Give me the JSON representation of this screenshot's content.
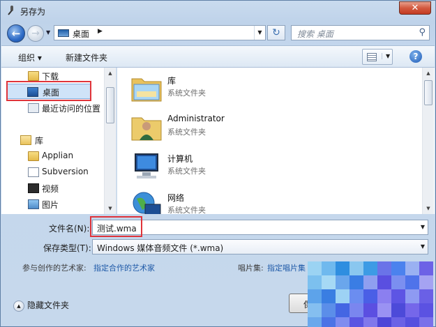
{
  "window": {
    "title": "另存为",
    "close_label": "✕"
  },
  "address_bar": {
    "back_icon": "arrow-left-icon",
    "forward_icon": "arrow-right-icon",
    "path_segment": "桌面",
    "search_placeholder": "搜索 桌面"
  },
  "toolbar": {
    "organize_label": "组织 ▾",
    "new_folder_label": "新建文件夹",
    "help_label": "?"
  },
  "nav_pane": {
    "items": [
      {
        "label": "下载",
        "icon": "folder-icon"
      },
      {
        "label": "桌面",
        "icon": "desktop-icon",
        "selected": true
      },
      {
        "label": "最近访问的位置",
        "icon": "recent-places-icon"
      },
      {
        "label": "库",
        "icon": "library-icon"
      },
      {
        "label": "Applian",
        "icon": "folder-icon"
      },
      {
        "label": "Subversion",
        "icon": "document-icon"
      },
      {
        "label": "视频",
        "icon": "video-icon"
      },
      {
        "label": "图片",
        "icon": "pictures-icon"
      }
    ]
  },
  "files": [
    {
      "name": "库",
      "type": "系统文件夹",
      "icon": "library-folder-icon"
    },
    {
      "name": "Administrator",
      "type": "系统文件夹",
      "icon": "user-folder-icon"
    },
    {
      "name": "计算机",
      "type": "系统文件夹",
      "icon": "computer-icon"
    },
    {
      "name": "网络",
      "type": "系统文件夹",
      "icon": "network-icon"
    }
  ],
  "form": {
    "filename_label": "文件名(N):",
    "filename_value": "测试.wma",
    "savetype_label": "保存类型(T):",
    "savetype_value": "Windows 媒体音频文件 (*.wma)",
    "artist_label": "参与创作的艺术家:",
    "artist_link": "指定合作的艺术家",
    "album_label": "唱片集:",
    "album_link": "指定唱片集"
  },
  "footer": {
    "hide_folders_label": "隐藏文件夹",
    "save_button_label": "保"
  },
  "colors": {
    "highlight_box": "#e0343a",
    "link": "#1f5aa8"
  }
}
